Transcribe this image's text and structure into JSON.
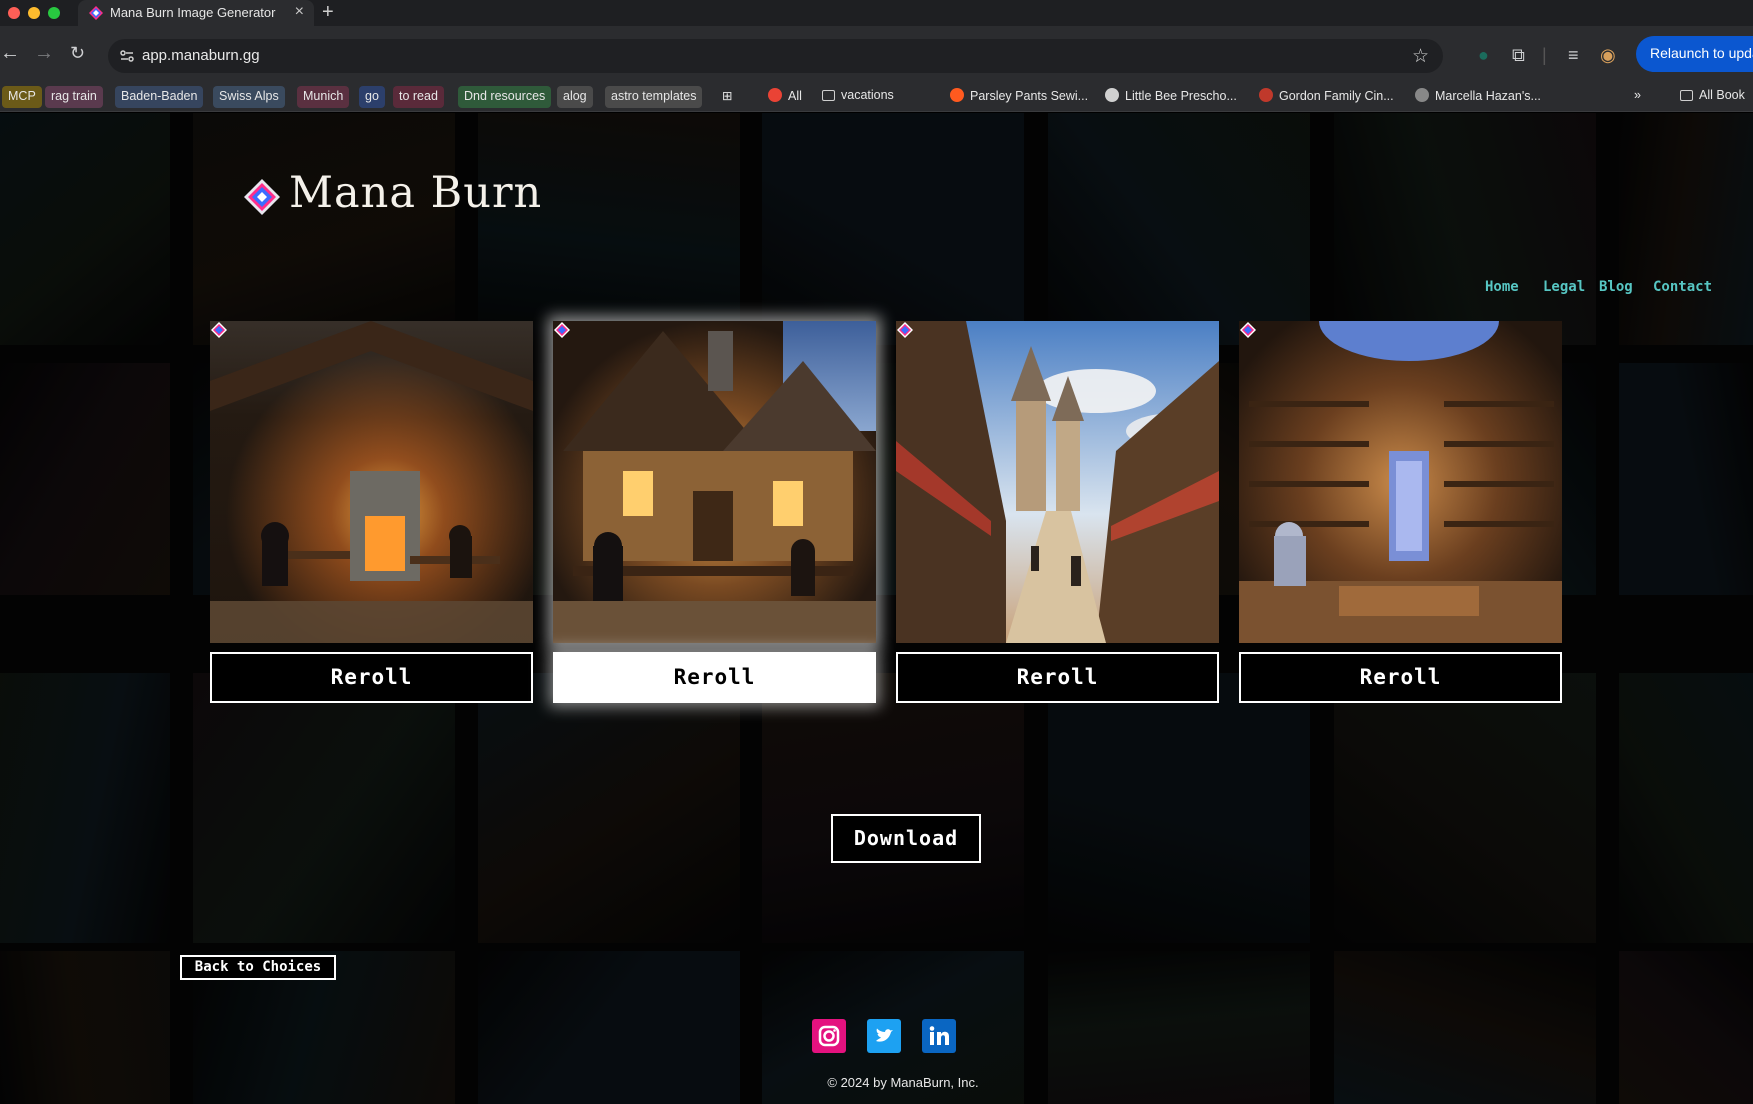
{
  "browser": {
    "tab_title": "Mana Burn Image Generator",
    "url": "app.manaburn.gg",
    "relaunch_label": "Relaunch to upda",
    "bookmarks": [
      {
        "label": "MCP",
        "bg": "#6b5a18"
      },
      {
        "label": "rag train",
        "bg": "#5a3a4e"
      },
      {
        "label": "Baden-Baden",
        "bg": "#36455e"
      },
      {
        "label": "Swiss Alps",
        "bg": "#3a4a5e"
      },
      {
        "label": "Munich",
        "bg": "#5a3040"
      },
      {
        "label": "go",
        "bg": "#2c3f6b"
      },
      {
        "label": "to read",
        "bg": "#5a2a3a"
      },
      {
        "label": "Dnd resources",
        "bg": "#2f5a3a"
      },
      {
        "label": "alog",
        "bg": "#4a4a4a"
      },
      {
        "label": "astro templates",
        "bg": "#4a4a4a"
      }
    ],
    "bookmarks_plain": [
      "All",
      "vacations",
      "Parsley Pants Sewi...",
      "Little Bee Prescho...",
      "Gordon Family Cin...",
      "Marcella Hazan's..."
    ],
    "more_label": "»",
    "all_bookmarks_label": "All Book"
  },
  "site": {
    "logo_text": "Mana Burn",
    "nav": [
      "Home",
      "Legal",
      "Blog",
      "Contact"
    ],
    "colors": {
      "nav": "#57c6c3",
      "accent_pink": "#ff2d8a",
      "accent_blue": "#3b6cff"
    }
  },
  "images": [
    {
      "scene": "forge-interior",
      "reroll_label": "Reroll",
      "selected": false
    },
    {
      "scene": "tavern-interior",
      "reroll_label": "Reroll",
      "selected": true
    },
    {
      "scene": "castle-market-street",
      "reroll_label": "Reroll",
      "selected": false
    },
    {
      "scene": "potion-shop-interior",
      "reroll_label": "Reroll",
      "selected": false
    }
  ],
  "actions": {
    "download_label": "Download",
    "back_label": "Back to Choices"
  },
  "footer": {
    "social": [
      {
        "name": "instagram-icon",
        "color": "#e4127f"
      },
      {
        "name": "twitter-icon",
        "color": "#1da1f2"
      },
      {
        "name": "linkedin-icon",
        "color": "#0a66c2"
      }
    ],
    "copyright": "© 2024 by ManaBurn, Inc."
  }
}
